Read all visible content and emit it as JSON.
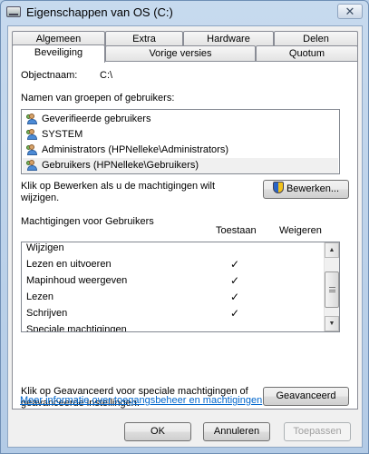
{
  "window": {
    "title": "Eigenschappen van OS (C:)",
    "close_glyph": "✕"
  },
  "tabs": {
    "row1": [
      "Algemeen",
      "Extra",
      "Hardware",
      "Delen"
    ],
    "row2": [
      "Beveiliging",
      "Vorige versies",
      "Quotum"
    ],
    "active": "Beveiliging"
  },
  "security": {
    "object_label": "Objectnaam:",
    "object_value": "C:\\",
    "groups_label": "Namen van groepen of gebruikers:",
    "groups": [
      {
        "name": "Geverifieerde gebruikers",
        "icon": "user-group-icon"
      },
      {
        "name": "SYSTEM",
        "icon": "user-group-icon"
      },
      {
        "name": "Administrators (HPNelleke\\Administrators)",
        "icon": "user-group-icon"
      },
      {
        "name": "Gebruikers (HPNelleke\\Gebruikers)",
        "icon": "user-group-icon"
      }
    ],
    "selected_group": 3,
    "edit_hint": "Klik op Bewerken als u de machtigingen wilt wijzigen.",
    "edit_hint_line1": "Klik op Bewerken als u de machtigingen wilt",
    "edit_hint_line2": "wijzigen.",
    "edit_button": "Bewerken...",
    "permissions_label": "Machtigingen voor Gebruikers",
    "col_allow": "Toestaan",
    "col_deny": "Weigeren",
    "permissions": [
      {
        "name": "Wijzigen",
        "allow": false,
        "deny": false
      },
      {
        "name": "Lezen en uitvoeren",
        "allow": true,
        "deny": false
      },
      {
        "name": "Mapinhoud weergeven",
        "allow": true,
        "deny": false
      },
      {
        "name": "Lezen",
        "allow": true,
        "deny": false
      },
      {
        "name": "Schrijven",
        "allow": true,
        "deny": false
      },
      {
        "name": "Speciale machtigingen",
        "allow": false,
        "deny": false
      }
    ],
    "check_glyph": "✓",
    "advanced_hint_line1": "Klik op Geavanceerd voor speciale machtigingen of",
    "advanced_hint_line2": "geavanceerde instellingen.",
    "advanced_button": "Geavanceerd",
    "help_link": "Meer informatie over toegangsbeheer en machtigingen"
  },
  "footer": {
    "ok": "OK",
    "cancel": "Annuleren",
    "apply": "Toepassen"
  },
  "colors": {
    "link": "#0066cc",
    "titlebar": "#c7daee"
  }
}
